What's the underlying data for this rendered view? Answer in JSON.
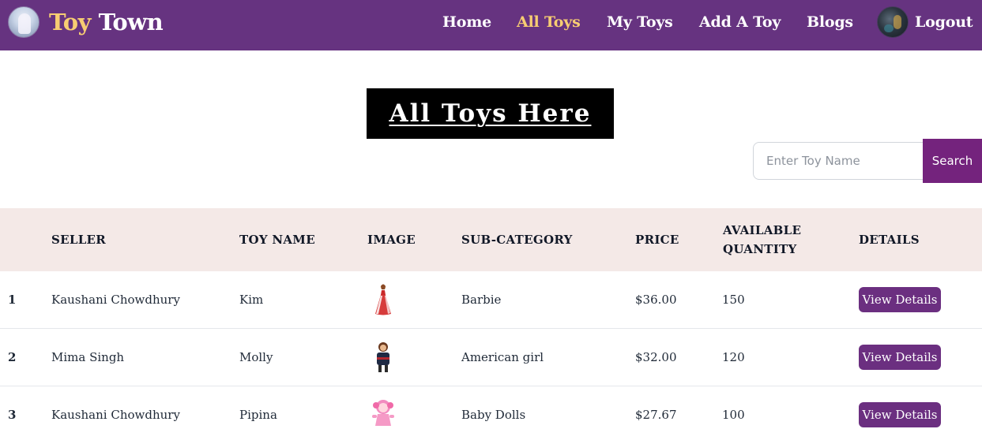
{
  "brand": {
    "name_part1": "Toy",
    "name_part2": "Town"
  },
  "nav": {
    "items": [
      {
        "label": "Home",
        "active": false
      },
      {
        "label": "All Toys",
        "active": true
      },
      {
        "label": "My Toys",
        "active": false
      },
      {
        "label": "Add A Toy",
        "active": false
      },
      {
        "label": "Blogs",
        "active": false
      }
    ],
    "logout_label": "Logout"
  },
  "page": {
    "heading": "All Toys Here"
  },
  "search": {
    "placeholder": "Enter Toy Name",
    "value": "",
    "button_label": "Search"
  },
  "table": {
    "headers": {
      "seller": "SELLER",
      "toy_name": "TOY NAME",
      "image": "IMAGE",
      "sub_category": "SUB-CATEGORY",
      "price": "PRICE",
      "available_quantity_line1": "AVAILABLE",
      "available_quantity_line2": "QUANTITY",
      "details": "DETAILS"
    },
    "rows": [
      {
        "num": "1",
        "seller": "Kaushani Chowdhury",
        "toy_name": "Kim",
        "image_icon": "barbie-doll-thumbnail",
        "sub_category": "Barbie",
        "price": "$36.00",
        "quantity": "150",
        "details_label": "View Details"
      },
      {
        "num": "2",
        "seller": "Mima Singh",
        "toy_name": "Molly",
        "image_icon": "american-girl-doll-thumbnail",
        "sub_category": "American girl",
        "price": "$32.00",
        "quantity": "120",
        "details_label": "View Details"
      },
      {
        "num": "3",
        "seller": "Kaushani Chowdhury",
        "toy_name": "Pipina",
        "image_icon": "baby-doll-thumbnail",
        "sub_category": "Baby Dolls",
        "price": "$27.67",
        "quantity": "100",
        "details_label": "View Details"
      }
    ]
  },
  "colors": {
    "navbar_bg": "#663380",
    "brand_accent": "#f7cd72",
    "search_button": "#74237d",
    "details_button": "#6b2f80",
    "table_header_bg": "#f4e9e7"
  }
}
